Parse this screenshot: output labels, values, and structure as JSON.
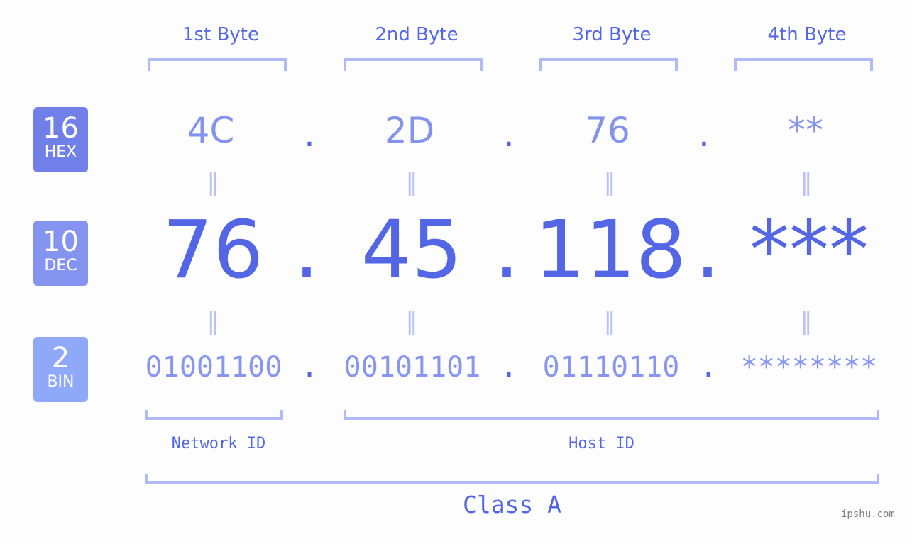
{
  "byte_headers": [
    "1st Byte",
    "2nd Byte",
    "3rd Byte",
    "4th Byte"
  ],
  "rows": {
    "hex": {
      "base": "16",
      "label": "HEX",
      "values": [
        "4C",
        "2D",
        "76",
        "**"
      ],
      "color": "#7080e8"
    },
    "dec": {
      "base": "10",
      "label": "DEC",
      "values": [
        "76",
        "45",
        "118",
        "***"
      ],
      "color": "#8494f0"
    },
    "bin": {
      "base": "2",
      "label": "BIN",
      "values": [
        "01001100",
        "00101101",
        "01110110",
        "********"
      ],
      "color": "#8fa8f8"
    }
  },
  "separator": ".",
  "equals": "=",
  "network_label": "Network ID",
  "host_label": "Host ID",
  "class_label": "Class A",
  "watermark": "ipshu.com",
  "colors": {
    "accent": "#5366e6",
    "bracket": "#b0baf8",
    "hex_text": "#8493ee"
  }
}
